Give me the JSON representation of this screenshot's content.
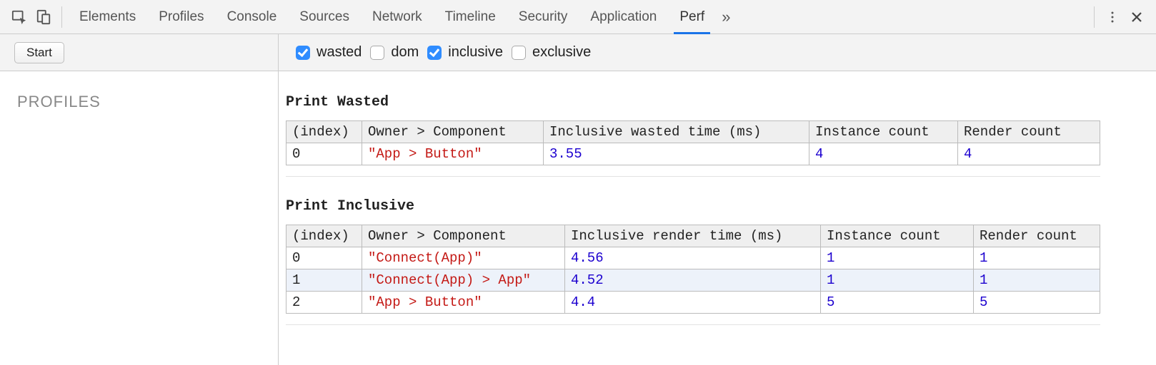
{
  "tabs": {
    "items": [
      "Elements",
      "Profiles",
      "Console",
      "Sources",
      "Network",
      "Timeline",
      "Security",
      "Application",
      "Perf"
    ],
    "active_index": 8,
    "more_glyph": "»"
  },
  "toolbar": {
    "start_label": "Start",
    "checks": {
      "wasted": {
        "label": "wasted",
        "checked": true
      },
      "dom": {
        "label": "dom",
        "checked": false
      },
      "inclusive": {
        "label": "inclusive",
        "checked": true
      },
      "exclusive": {
        "label": "exclusive",
        "checked": false
      }
    }
  },
  "sidebar": {
    "heading": "PROFILES"
  },
  "tables": {
    "wasted": {
      "title": "Print Wasted",
      "columns": [
        "(index)",
        "Owner > Component",
        "Inclusive wasted time (ms)",
        "Instance count",
        "Render count"
      ],
      "rows": [
        {
          "index": "0",
          "owner": "\"App > Button\"",
          "time": "3.55",
          "instances": "4",
          "renders": "4"
        }
      ]
    },
    "inclusive": {
      "title": "Print Inclusive",
      "columns": [
        "(index)",
        "Owner > Component",
        "Inclusive render time (ms)",
        "Instance count",
        "Render count"
      ],
      "rows": [
        {
          "index": "0",
          "owner": "\"Connect(App)\"",
          "time": "4.56",
          "instances": "1",
          "renders": "1"
        },
        {
          "index": "1",
          "owner": "\"Connect(App) > App\"",
          "time": "4.52",
          "instances": "1",
          "renders": "1",
          "striped": true
        },
        {
          "index": "2",
          "owner": "\"App > Button\"",
          "time": "4.4",
          "instances": "5",
          "renders": "5"
        }
      ]
    }
  }
}
